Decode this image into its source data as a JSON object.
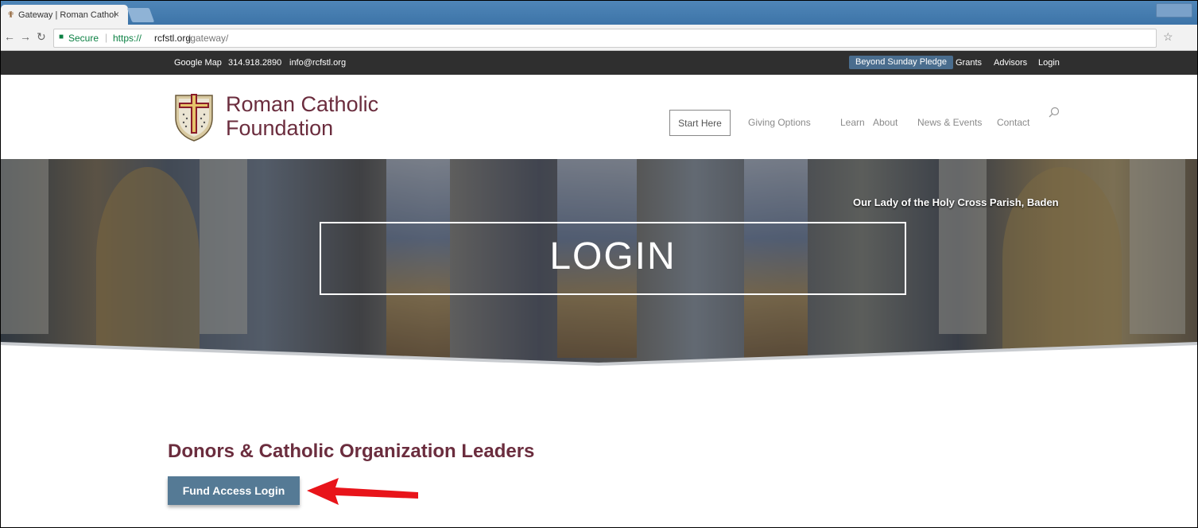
{
  "browser": {
    "tab_title": "Gateway | Roman Cathol",
    "tab_close": "×",
    "url_secure_label": "Secure",
    "url_separator": "|",
    "url_protocol": "https://",
    "url_host": "rcfstl.org",
    "url_path": "/gateway/"
  },
  "topbar": {
    "google_map": "Google Map",
    "phone": "314.918.2890",
    "email": "info@rcfstl.org",
    "pledge": "Beyond Sunday Pledge",
    "grants": "Grants",
    "advisors": "Advisors",
    "login": "Login"
  },
  "header": {
    "brand_line1": "Roman Catholic",
    "brand_line2": "Foundation",
    "start_here": "Start Here",
    "nav": [
      "Giving Options",
      "Learn",
      "About",
      "News & Events",
      "Contact"
    ]
  },
  "hero": {
    "caption": "Our Lady of the Holy Cross Parish, Baden",
    "title": "LOGIN"
  },
  "content": {
    "heading": "Donors & Catholic Organization Leaders",
    "fund_button": "Fund Access Login"
  },
  "colors": {
    "brand": "#6b2d3e",
    "button": "#557a95",
    "arrow": "#e8141a",
    "topbar": "#2f2f2f"
  }
}
